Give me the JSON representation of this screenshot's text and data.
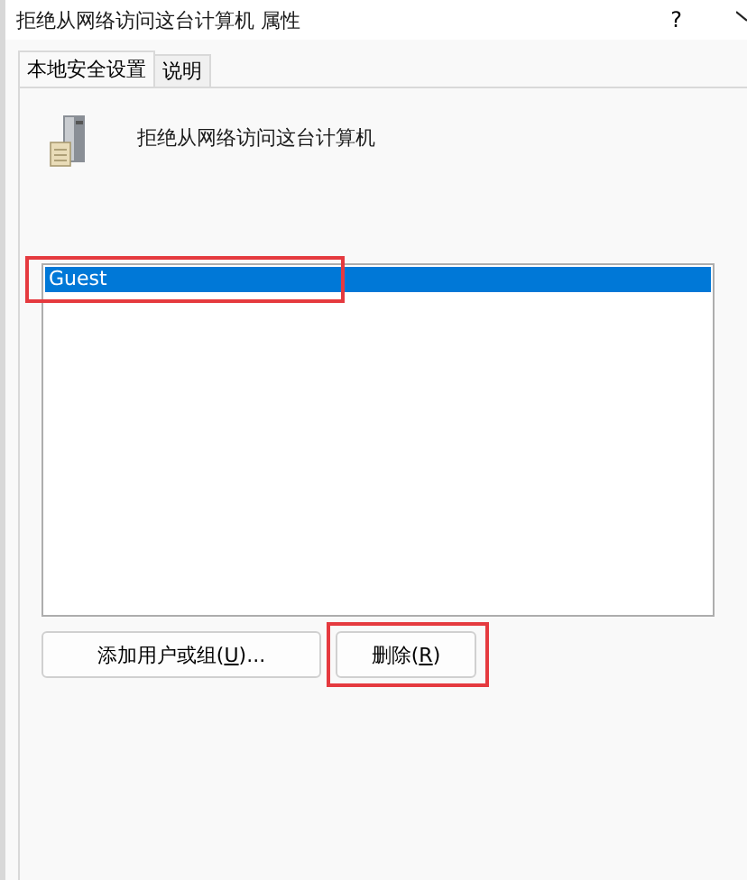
{
  "window": {
    "title": "拒绝从网络访问这台计算机 属性",
    "help": "?"
  },
  "tabs": [
    {
      "label": "本地安全设置",
      "selected": true
    },
    {
      "label": "说明",
      "selected": false
    }
  ],
  "policy": {
    "name": "拒绝从网络访问这台计算机"
  },
  "accounts": [
    {
      "name": "Guest",
      "selected": true,
      "highlighted": true
    }
  ],
  "buttons": [
    {
      "label": "添加用户或组(",
      "access_key": "U",
      "label_end": ")...",
      "highlighted": false
    },
    {
      "label": "删除(",
      "access_key": "R",
      "label_end": ")",
      "highlighted": true
    }
  ]
}
